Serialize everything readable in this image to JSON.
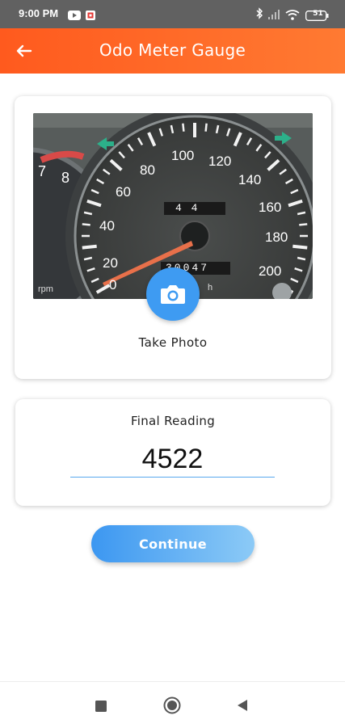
{
  "status_bar": {
    "time": "9:00 PM",
    "icons": [
      "youtube-icon",
      "app-notification-icon",
      "bluetooth-icon",
      "signal-icon",
      "wifi-icon",
      "battery-icon"
    ],
    "battery_level": "51"
  },
  "header": {
    "title": "Odo Meter Gauge",
    "back_icon": "arrow-left-icon",
    "color": "#ff6a28"
  },
  "photo_card": {
    "image_description_icon": "odometer-photo",
    "speed_labels": [
      "0",
      "20",
      "40",
      "60",
      "80",
      "100",
      "120",
      "140",
      "160",
      "180",
      "200"
    ],
    "tach_labels": [
      "7",
      "8"
    ],
    "tach_unit": "rpm",
    "trip_counter": "4 4",
    "odometer_counter": "30047",
    "odo_unit": "h",
    "camera_icon": "camera-icon",
    "take_photo_label": "Take Photo"
  },
  "reading_card": {
    "label": "Final Reading",
    "value": "4522"
  },
  "continue_button": {
    "label": "Continue",
    "color": "#3c97f1"
  },
  "nav_bar": {
    "icons": [
      "recent-apps-icon",
      "home-icon",
      "back-icon"
    ]
  }
}
